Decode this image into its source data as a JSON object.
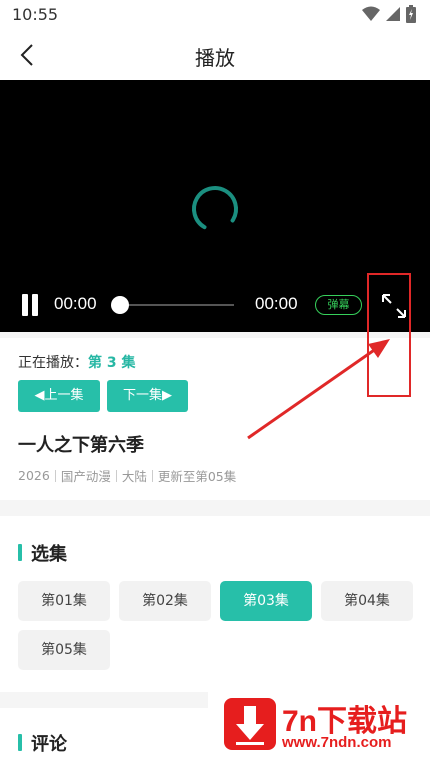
{
  "status_bar": {
    "time": "10:55",
    "icons": [
      "wifi-icon",
      "signal-icon",
      "battery-icon"
    ]
  },
  "app_bar": {
    "title": "播放",
    "back_icon": "chevron-left-icon"
  },
  "player": {
    "current_time": "00:00",
    "total_time": "00:00",
    "progress": 0,
    "danmaku_label": "弹幕",
    "state": "loading"
  },
  "episode_info": {
    "now_playing_label": "正在播放：",
    "now_playing_value": "第 3 集",
    "prev_label": "◀上一集",
    "next_label": "下一集▶",
    "title": "一人之下第六季",
    "meta": [
      "2026",
      "国产动漫",
      "大陆",
      "更新至第05集"
    ]
  },
  "episodes": {
    "section_title": "选集",
    "items": [
      "第01集",
      "第02集",
      "第03集",
      "第04集",
      "第05集"
    ],
    "active_index": 2
  },
  "comments": {
    "section_title": "评论"
  },
  "watermark": {
    "text": "7n下载站",
    "url": "www.7ndn.com"
  },
  "colors": {
    "accent": "#27bfa9",
    "danmaku": "#36d05b",
    "annotation": "#e02828",
    "watermark": "#e61e1e"
  }
}
